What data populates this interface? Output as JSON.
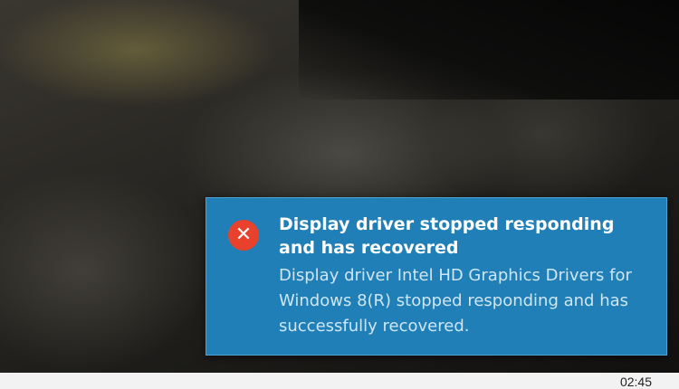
{
  "notification": {
    "icon": "error-icon",
    "icon_glyph": "✕",
    "title": "Display driver stopped responding and has recovered",
    "body": "Display driver Intel HD Graphics Drivers for Windows 8(R) stopped responding and has successfully recovered.",
    "colors": {
      "background": "#1f7fb6",
      "icon_background": "#e8412c"
    }
  },
  "taskbar": {
    "clock": "02:45"
  }
}
